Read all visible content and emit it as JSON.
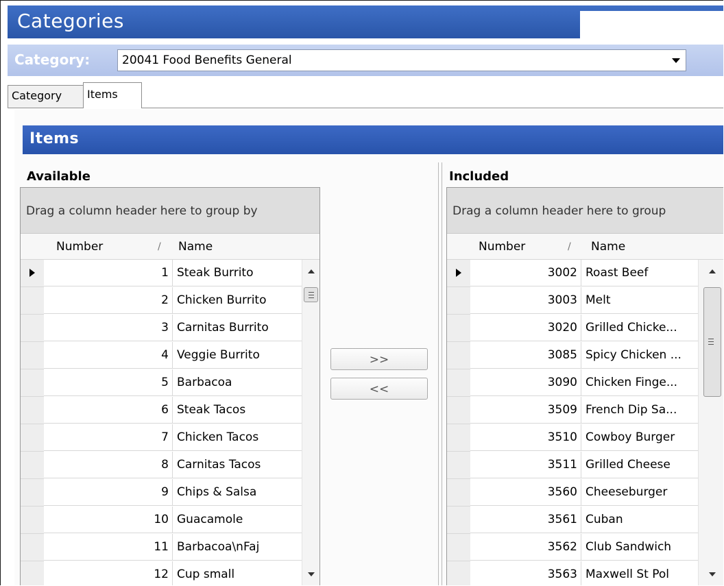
{
  "window": {
    "title": "Categories"
  },
  "category_bar": {
    "label": "Category:",
    "selected": "20041 Food Benefits General"
  },
  "tabs": [
    {
      "label": "Category"
    },
    {
      "label": "Items"
    }
  ],
  "items_panel": {
    "title": "Items"
  },
  "available": {
    "title": "Available",
    "group_hint": "Drag a column header here to group by",
    "columns": {
      "number": "Number",
      "name": "Name"
    },
    "rows": [
      {
        "number": "1",
        "name": "Steak Burrito"
      },
      {
        "number": "2",
        "name": "Chicken Burrito"
      },
      {
        "number": "3",
        "name": "Carnitas Burrito"
      },
      {
        "number": "4",
        "name": "Veggie Burrito"
      },
      {
        "number": "5",
        "name": "Barbacoa"
      },
      {
        "number": "6",
        "name": "Steak Tacos"
      },
      {
        "number": "7",
        "name": "Chicken Tacos"
      },
      {
        "number": "8",
        "name": "Carnitas Tacos"
      },
      {
        "number": "9",
        "name": "Chips & Salsa"
      },
      {
        "number": "10",
        "name": "Guacamole"
      },
      {
        "number": "11",
        "name": "Barbacoa\\nFaj"
      },
      {
        "number": "12",
        "name": "Cup small"
      }
    ]
  },
  "included": {
    "title": "Included",
    "group_hint": "Drag a column header here to group",
    "columns": {
      "number": "Number",
      "name": "Name"
    },
    "rows": [
      {
        "number": "3002",
        "name": "Roast Beef"
      },
      {
        "number": "3003",
        "name": "Melt"
      },
      {
        "number": "3020",
        "name": "Grilled Chicke..."
      },
      {
        "number": "3085",
        "name": "Spicy Chicken ..."
      },
      {
        "number": "3090",
        "name": "Chicken Finge..."
      },
      {
        "number": "3509",
        "name": "French Dip Sa..."
      },
      {
        "number": "3510",
        "name": "Cowboy Burger"
      },
      {
        "number": "3511",
        "name": "Grilled Cheese"
      },
      {
        "number": "3560",
        "name": "Cheeseburger"
      },
      {
        "number": "3561",
        "name": "Cuban"
      },
      {
        "number": "3562",
        "name": "Club Sandwich"
      },
      {
        "number": "3563",
        "name": "Maxwell St Pol"
      }
    ]
  },
  "buttons": {
    "add": ">>",
    "remove": "<<"
  },
  "colors": {
    "title_bar": "#2f5eb8",
    "category_bar": "#bccbee",
    "section_bar": "#2f5db7"
  }
}
